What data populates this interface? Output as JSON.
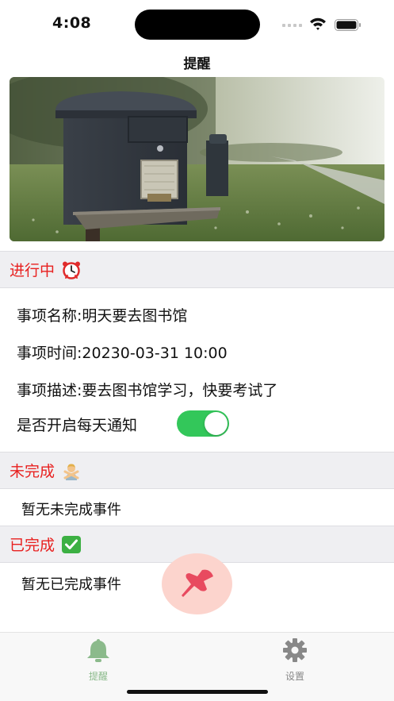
{
  "status_bar": {
    "time": "4:08"
  },
  "nav": {
    "title": "提醒"
  },
  "sections": {
    "in_progress": {
      "title": "进行中",
      "emoji": "alarm-clock"
    },
    "incomplete": {
      "title": "未完成",
      "emoji": "person-gesturing-no",
      "empty_text": "暂无未完成事件"
    },
    "completed": {
      "title": "已完成",
      "emoji": "check-mark-button",
      "empty_text": "暂无已完成事件"
    }
  },
  "task": {
    "name": "事项名称:明天要去图书馆",
    "time": "事项时间:20230-03-31 10:00",
    "description": "事项描述:要去图书馆学习，快要考试了",
    "daily_notify_label": "是否开启每天通知",
    "daily_notify_on": true
  },
  "tabs": [
    {
      "label": "提醒",
      "icon": "bell-icon",
      "active": true
    },
    {
      "label": "设置",
      "icon": "gear-icon",
      "active": false
    }
  ],
  "colors": {
    "section_title": "#e8201f",
    "toggle_on": "#33c75a",
    "tab_active": "#8bba8b",
    "tab_inactive": "#888888",
    "fab_bg": "#fcd4cd",
    "fab_icon": "#e84a5f"
  }
}
